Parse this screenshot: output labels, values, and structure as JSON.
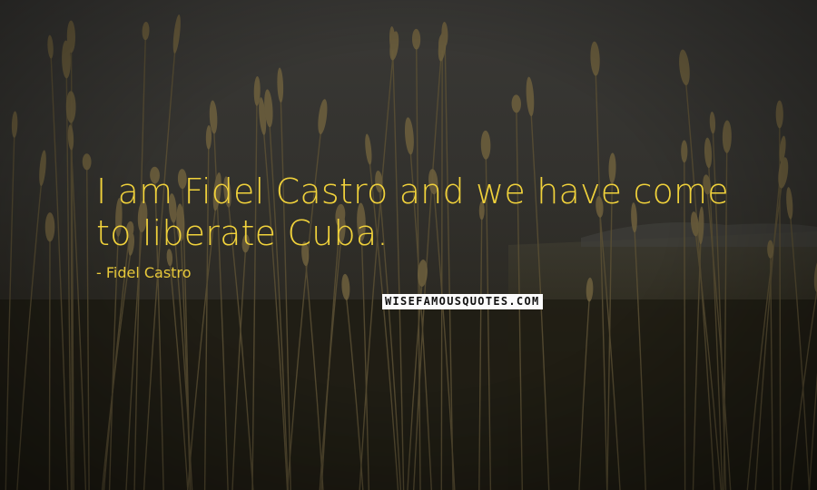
{
  "quote": {
    "text": "I am Fidel Castro and we have come to liberate Cuba.",
    "author": "- Fidel Castro",
    "text_color": "#f1d23b"
  },
  "watermark": {
    "text": "WISEFAMOUSQUOTES.COM"
  },
  "background": {
    "subject": "wheat-field-at-dusk",
    "sky_color": "#3a3936",
    "field_color": "#2a2618",
    "stalk_color": "#5a4f33"
  }
}
